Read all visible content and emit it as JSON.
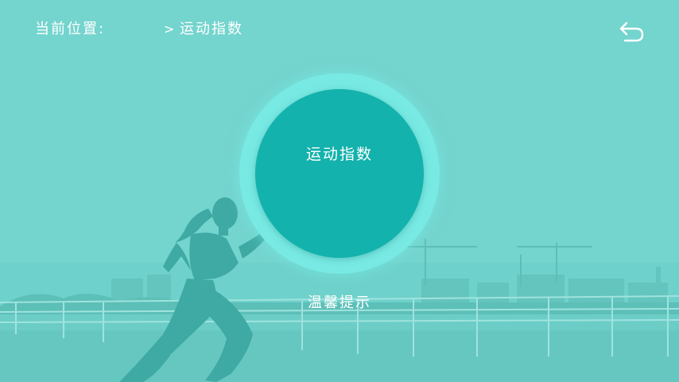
{
  "header": {
    "location_label": "当前位置:",
    "separator": ">",
    "current_page": "运动指数"
  },
  "main": {
    "circle_title": "运动指数",
    "tip_link": "温馨提示"
  },
  "icons": {
    "back": "back-arrow-icon"
  },
  "colors": {
    "overlay": "#6fd1cb",
    "circle_ring": "#74e7e1",
    "circle_fill": "#14b2ac",
    "text": "#ffffff"
  }
}
